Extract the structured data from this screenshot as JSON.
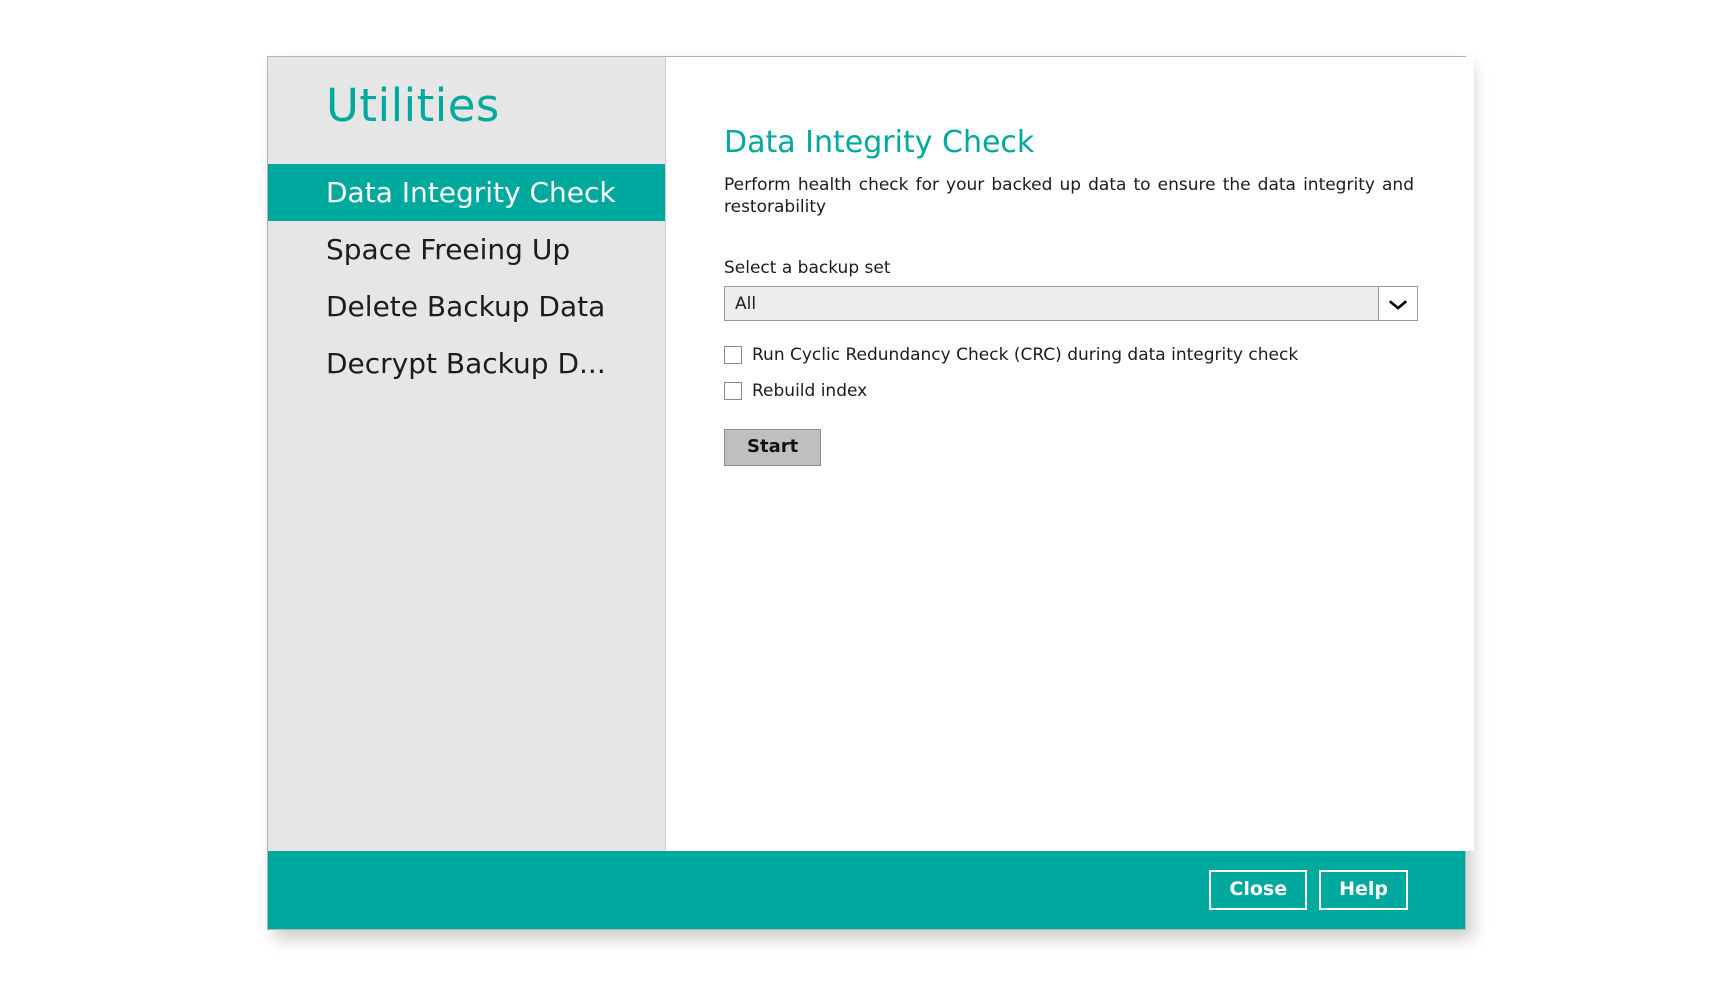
{
  "window": {
    "title": "Utilities"
  },
  "sidebar": {
    "title": "Utilities",
    "items": [
      {
        "label": "Data Integrity Check",
        "active": true
      },
      {
        "label": "Space Freeing Up",
        "active": false
      },
      {
        "label": "Delete Backup Data",
        "active": false
      },
      {
        "label": "Decrypt Backup D...",
        "active": false
      }
    ]
  },
  "content": {
    "title": "Data Integrity Check",
    "description": "Perform health check for your backed up data to ensure the data integrity and restorability",
    "select_label": "Select a backup set",
    "backup_set": {
      "value": "All",
      "options": [
        "All"
      ],
      "arrow_icon": "chevron-down-icon"
    },
    "checkboxes": [
      {
        "label": "Run Cyclic Redundancy Check (CRC) during data integrity check",
        "checked": false
      },
      {
        "label": "Rebuild index",
        "checked": false
      }
    ],
    "start_button": "Start"
  },
  "footer": {
    "close_label": "Close",
    "help_label": "Help"
  },
  "colors": {
    "accent": "#00a99d",
    "sidebar_bg": "#e6e6e6",
    "content_bg": "#ffffff",
    "text": "#1c1c1c",
    "button_bg": "#bfbfbf",
    "field_bg": "#ededed"
  }
}
